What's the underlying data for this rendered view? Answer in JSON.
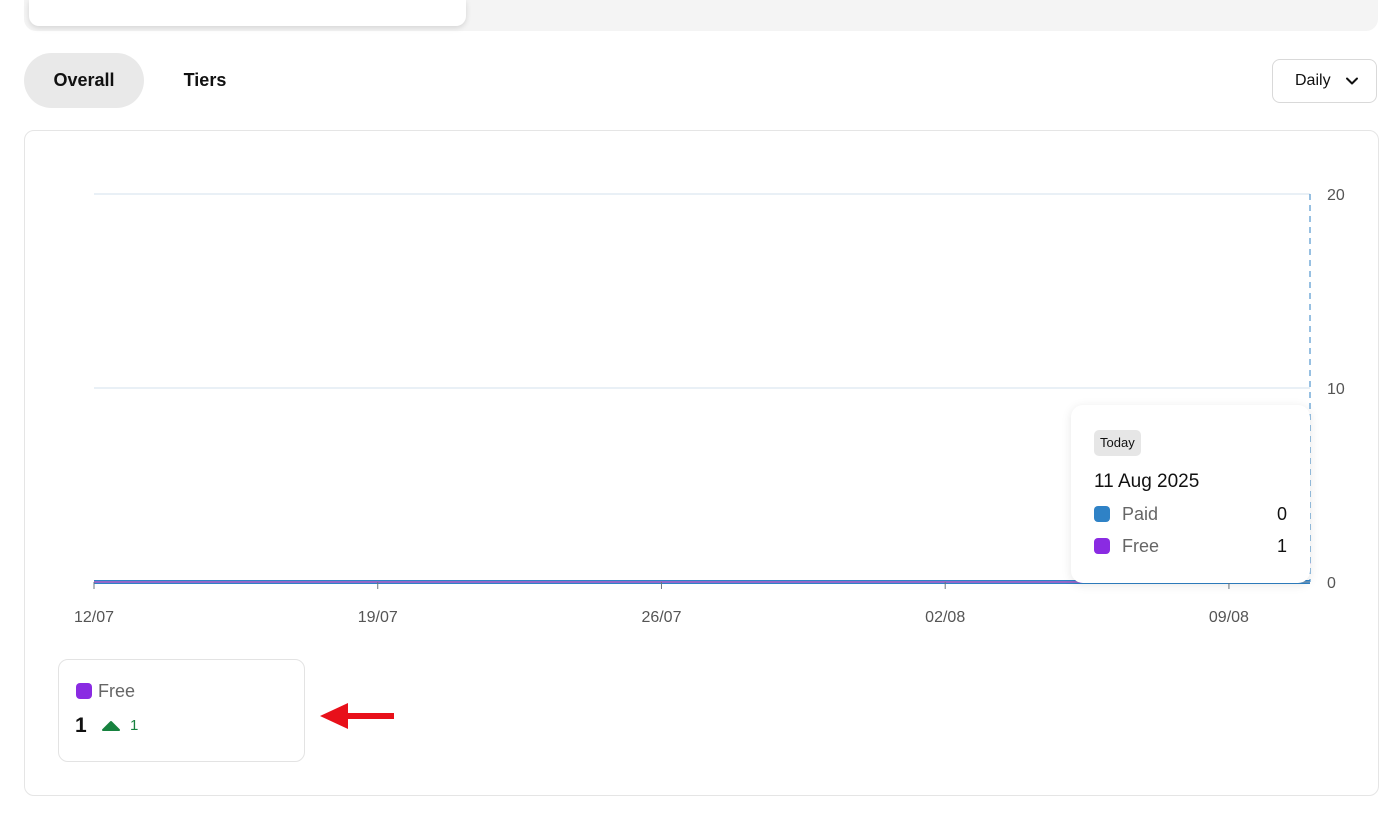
{
  "tabs": [
    {
      "label": "Overall",
      "active": true
    },
    {
      "label": "Tiers",
      "active": false
    }
  ],
  "period_select": {
    "value": "Daily"
  },
  "colors": {
    "paid": "#2f82c6",
    "free": "#8a2be2",
    "up": "#17823f",
    "annotation_arrow": "#e8101a"
  },
  "chart_data": {
    "type": "line",
    "x": [
      "12/07",
      "13/07",
      "14/07",
      "15/07",
      "16/07",
      "17/07",
      "18/07",
      "19/07",
      "20/07",
      "21/07",
      "22/07",
      "23/07",
      "24/07",
      "25/07",
      "26/07",
      "27/07",
      "28/07",
      "29/07",
      "30/07",
      "31/07",
      "01/08",
      "02/08",
      "03/08",
      "04/08",
      "05/08",
      "06/08",
      "07/08",
      "08/08",
      "09/08",
      "10/08",
      "11/08"
    ],
    "x_tick_labels": [
      "12/07",
      "19/07",
      "26/07",
      "02/08",
      "09/08"
    ],
    "series": [
      {
        "name": "Paid",
        "values": [
          0,
          0,
          0,
          0,
          0,
          0,
          0,
          0,
          0,
          0,
          0,
          0,
          0,
          0,
          0,
          0,
          0,
          0,
          0,
          0,
          0,
          0,
          0,
          0,
          0,
          0,
          0,
          0,
          0,
          0,
          0
        ]
      },
      {
        "name": "Free",
        "values": [
          0,
          0,
          0,
          0,
          0,
          0,
          0,
          0,
          0,
          0,
          0,
          0,
          0,
          0,
          0,
          0,
          0,
          0,
          0,
          0,
          0,
          0,
          0,
          0,
          0,
          0,
          0,
          0,
          0,
          0,
          1
        ]
      }
    ],
    "ylim": [
      0,
      20
    ],
    "y_ticks": [
      0,
      10,
      20
    ],
    "y_axis_side": "right",
    "grid": true,
    "hover_index": 30
  },
  "tooltip": {
    "badge": "Today",
    "date": "11 Aug 2025",
    "rows": [
      {
        "label": "Paid",
        "value": "0"
      },
      {
        "label": "Free",
        "value": "1"
      }
    ]
  },
  "legend_card": {
    "name": "Free",
    "value": "1",
    "delta": "1",
    "trend_icon": "triangle-up-icon"
  }
}
